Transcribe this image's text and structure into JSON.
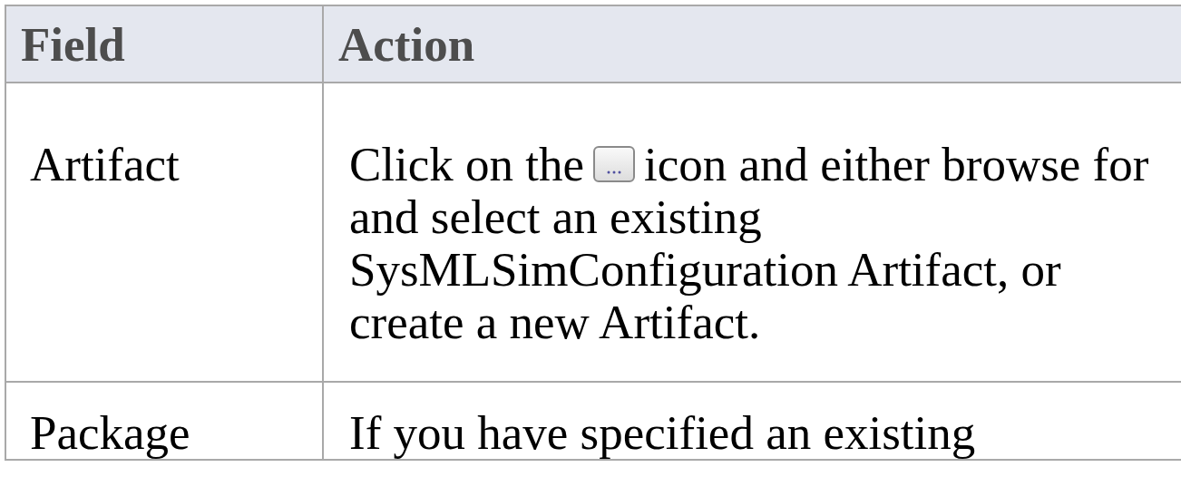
{
  "table": {
    "columns": [
      "Field",
      "Action"
    ],
    "rows": [
      {
        "field": "Artifact",
        "action": [
          [
            {
              "kind": "text",
              "text": "Click on the"
            },
            {
              "kind": "icon"
            },
            {
              "kind": "text",
              "text": "icon and either browse for"
            }
          ],
          [
            {
              "kind": "text",
              "text": "and select an existing"
            }
          ],
          [
            {
              "kind": "text",
              "text": "SysMLSimConfiguration Artifact, or"
            }
          ],
          [
            {
              "kind": "text",
              "text": "create a new Artifact."
            }
          ]
        ]
      },
      {
        "field": "Package",
        "action": [
          [
            {
              "kind": "text",
              "text": "If you have specified an existing"
            }
          ]
        ]
      }
    ]
  }
}
